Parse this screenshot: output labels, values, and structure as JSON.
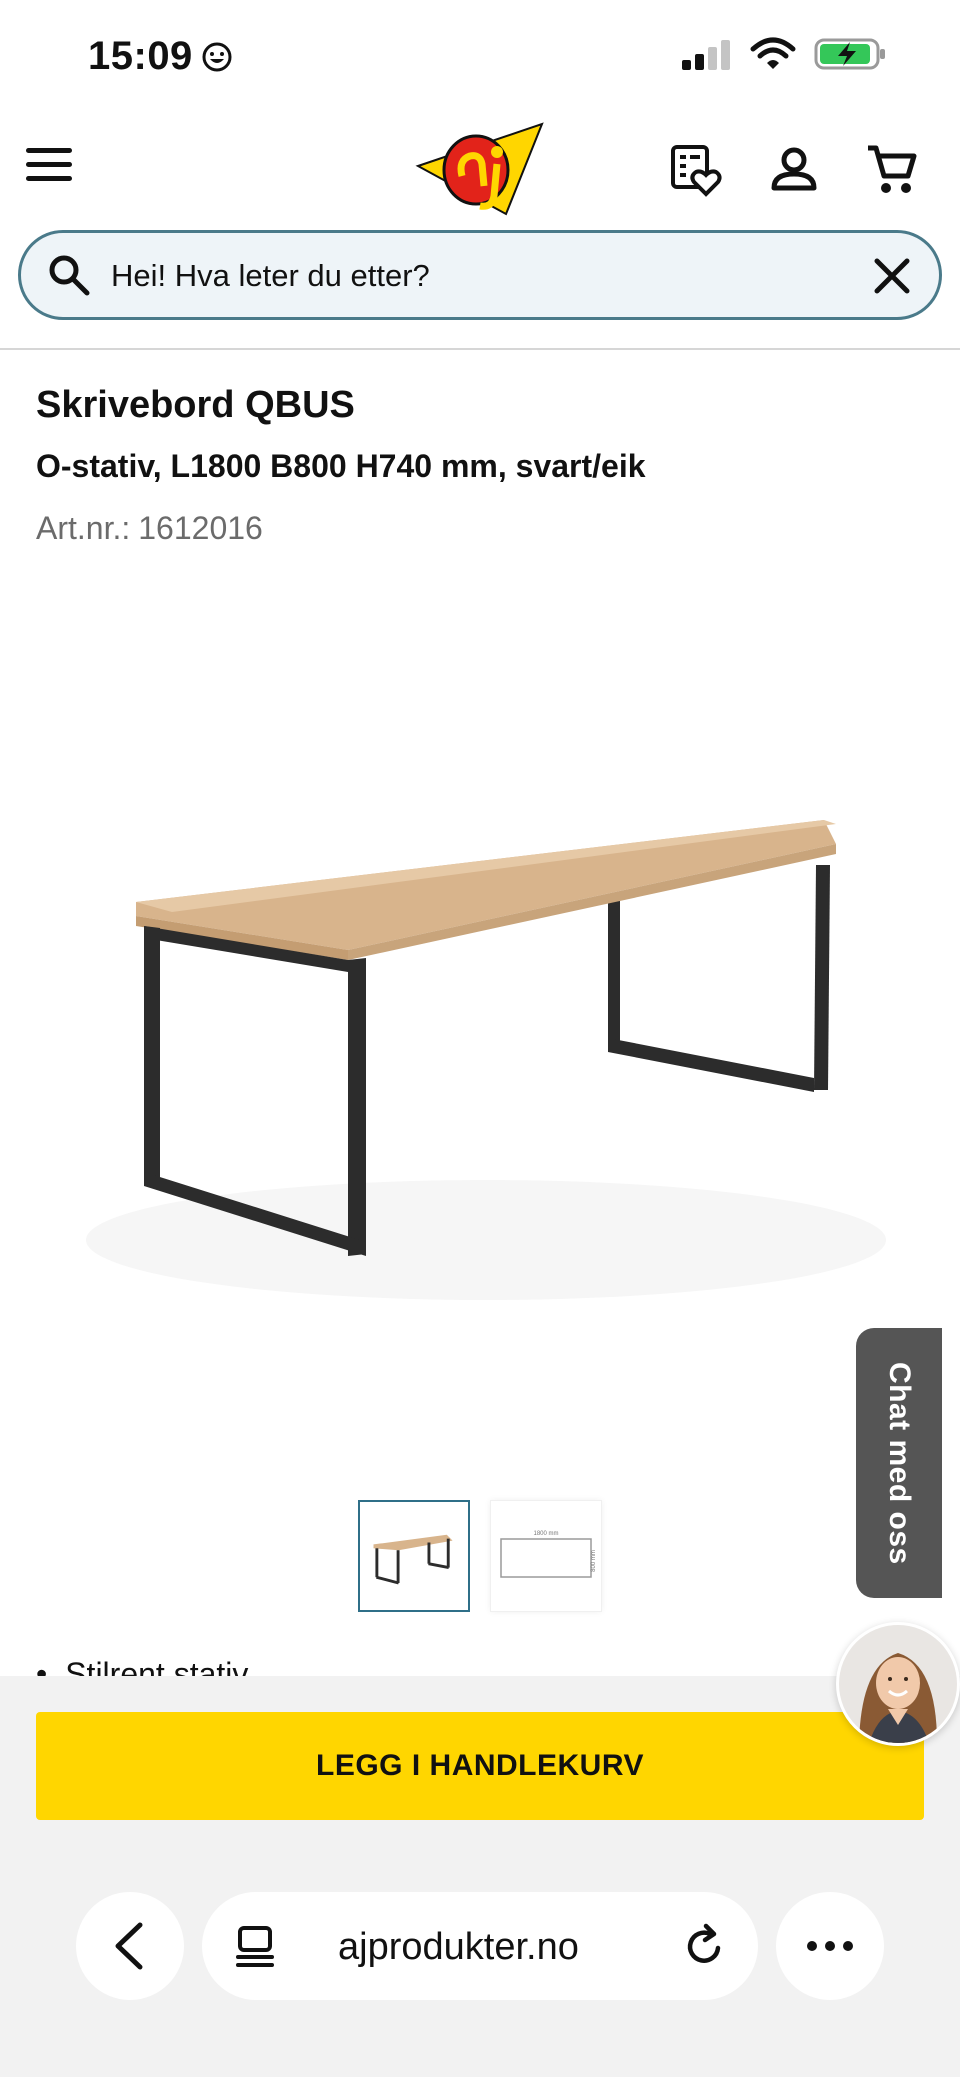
{
  "status_bar": {
    "time": "15:09"
  },
  "search": {
    "placeholder": "Hei! Hva leter du etter?"
  },
  "product": {
    "title": "Skrivebord QBUS",
    "subtitle": "O-stativ, L1800 B800 H740 mm, svart/eik",
    "art_label": "Art.nr.:",
    "art_number": "1612016",
    "bullet_peek": "Stilrent stativ"
  },
  "thumbnail_2": {
    "dim_width": "1800 mm",
    "dim_depth": "800 mm"
  },
  "chat": {
    "label": "Chat med oss"
  },
  "actions": {
    "add_to_cart": "LEGG I HANDLEKURV"
  },
  "browser": {
    "url": "ajprodukter.no"
  },
  "colors": {
    "accent_yellow": "#ffd600",
    "search_border": "#4a7a8a",
    "search_bg": "#eef4f8",
    "chat_tab": "#555555"
  }
}
